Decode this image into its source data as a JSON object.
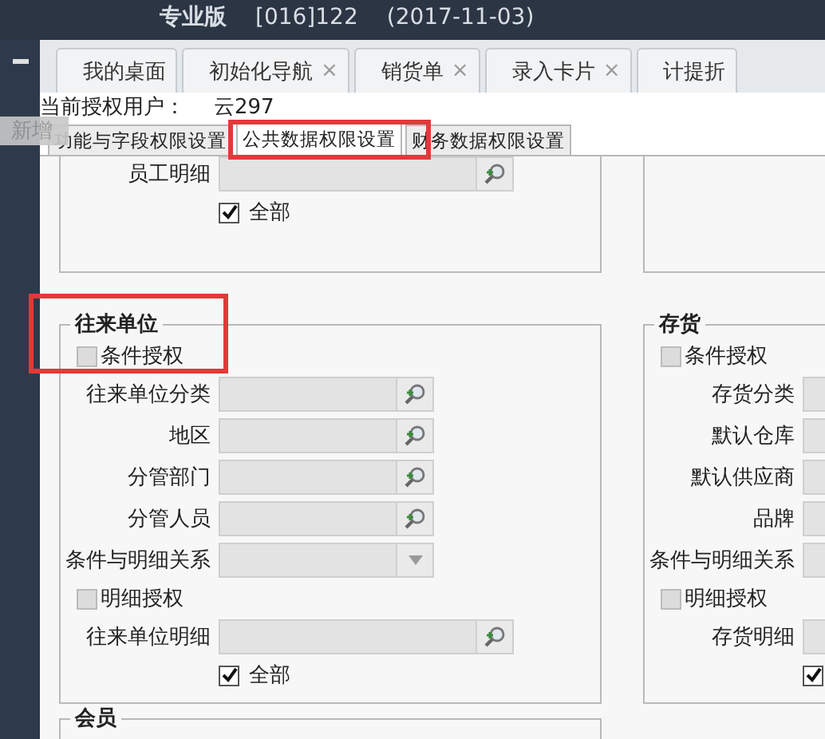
{
  "title_bar": {
    "product": "专业版",
    "account": "[016]122",
    "date": "(2017-11-03)"
  },
  "tabs": [
    {
      "label": "我的桌面",
      "selected": false
    },
    {
      "label": "初始化导航",
      "close": "×",
      "selected": false
    },
    {
      "label": "销货单",
      "close": "×",
      "selected": false
    },
    {
      "label": "录入卡片",
      "close": "×",
      "selected": false
    },
    {
      "label": "计提折",
      "selected": false
    }
  ],
  "user": {
    "label": "当前授权用户：",
    "value": "云297"
  },
  "popup": {
    "label": "新增"
  },
  "subtabs": [
    {
      "label": "功能与字段权限设置",
      "selected": false
    },
    {
      "label": "公共数据权限设置",
      "selected": true
    },
    {
      "label": "财务数据权限设置",
      "selected": false
    }
  ],
  "top_group": {
    "rows": [
      {
        "kind": "search_wide",
        "label": "员工明细"
      },
      {
        "kind": "check",
        "label": "全部",
        "checked": true
      }
    ]
  },
  "groups": [
    {
      "title": "往来单位",
      "rows": [
        {
          "kind": "section_check",
          "label": "条件授权",
          "checked": false
        },
        {
          "kind": "search",
          "label": "往来单位分类"
        },
        {
          "kind": "search",
          "label": "地区"
        },
        {
          "kind": "search",
          "label": "分管部门"
        },
        {
          "kind": "search",
          "label": "分管人员"
        },
        {
          "kind": "dropdown",
          "label": "条件与明细关系"
        },
        {
          "kind": "section_check",
          "label": "明细授权",
          "checked": false
        },
        {
          "kind": "search_wide",
          "label": "往来单位明细"
        },
        {
          "kind": "check",
          "label": "全部",
          "checked": true
        }
      ]
    },
    {
      "title": "存货",
      "rows": [
        {
          "kind": "section_check",
          "label": "条件授权",
          "checked": false
        },
        {
          "kind": "search",
          "label": "存货分类"
        },
        {
          "kind": "search",
          "label": "默认仓库"
        },
        {
          "kind": "search",
          "label": "默认供应商"
        },
        {
          "kind": "search",
          "label": "品牌"
        },
        {
          "kind": "dropdown",
          "label": "条件与明细关系"
        },
        {
          "kind": "section_check",
          "label": "明细授权",
          "checked": false
        },
        {
          "kind": "search_wide",
          "label": "存货明细"
        },
        {
          "kind": "check",
          "checked": true
        }
      ]
    }
  ],
  "bottom_group": {
    "title": "会员"
  }
}
